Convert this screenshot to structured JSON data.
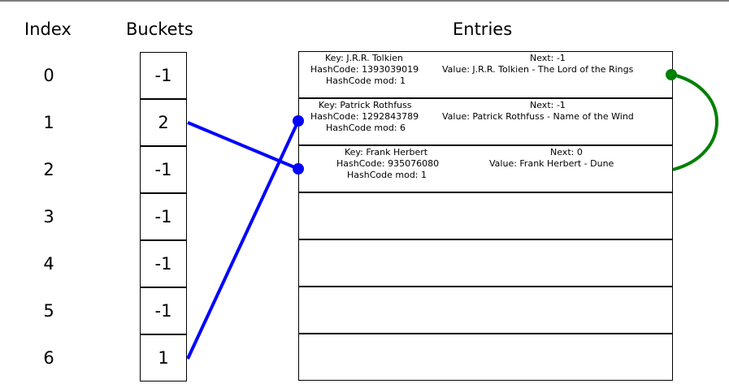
{
  "headers": {
    "index": "Index",
    "buckets": "Buckets",
    "entries": "Entries"
  },
  "indices": [
    "0",
    "1",
    "2",
    "3",
    "4",
    "5",
    "6"
  ],
  "buckets": [
    "-1",
    "2",
    "-1",
    "-1",
    "-1",
    "-1",
    "1"
  ],
  "entries": [
    {
      "key": "Key: J.R.R. Tolkien",
      "hash": "HashCode: 1393039019",
      "mod": "HashCode mod: 1",
      "next": "Next: -1",
      "value": "Value: J.R.R. Tolkien - The Lord of the Rings"
    },
    {
      "key": "Key: Patrick Rothfuss",
      "hash": "HashCode: 1292843789",
      "mod": "HashCode mod: 6",
      "next": "Next: -1",
      "value": "Value: Patrick Rothfuss - Name of the Wind"
    },
    {
      "key": "Key: Frank Herbert",
      "hash": "HashCode: 935076080",
      "mod": "HashCode mod: 1",
      "next": "Next: 0",
      "value": "Value: Frank Herbert - Dune"
    }
  ],
  "empty_entry_rows": 4,
  "colors": {
    "bucket_link": "#0000ff",
    "next_link": "#008000",
    "border": "#000000"
  }
}
